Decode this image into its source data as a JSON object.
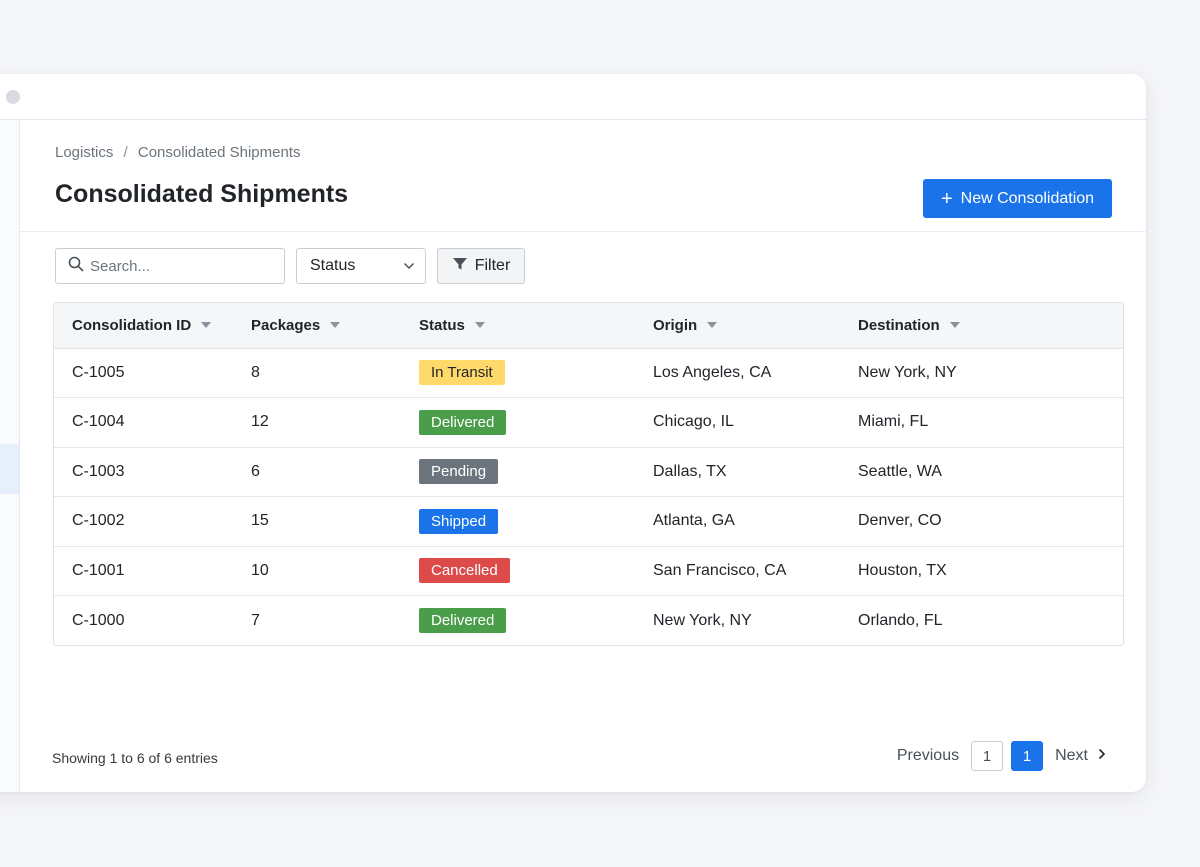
{
  "breadcrumb": {
    "root": "Logistics",
    "separator": "/",
    "current": "Consolidated Shipments"
  },
  "page": {
    "title": "Consolidated Shipments",
    "new_button": "New Consolidation"
  },
  "toolbar": {
    "search_placeholder": "Search...",
    "status_select": "Status",
    "filter_label": "Filter"
  },
  "table": {
    "headers": [
      "Consolidation ID",
      "Packages",
      "Status",
      "Origin",
      "Destination"
    ],
    "rows": [
      {
        "id": "C-1005",
        "packages": "8",
        "status": "In Transit",
        "origin": "Los Angeles, CA",
        "destination": "New York, NY"
      },
      {
        "id": "C-1004",
        "packages": "12",
        "status": "Delivered",
        "origin": "Chicago, IL",
        "destination": "Miami, FL"
      },
      {
        "id": "C-1003",
        "packages": "6",
        "status": "Pending",
        "origin": "Dallas, TX",
        "destination": "Seattle, WA"
      },
      {
        "id": "C-1002",
        "packages": "15",
        "status": "Shipped",
        "origin": "Atlanta, GA",
        "destination": "Denver, CO"
      },
      {
        "id": "C-1001",
        "packages": "10",
        "status": "Cancelled",
        "origin": "San Francisco, CA",
        "destination": "Houston, TX"
      },
      {
        "id": "C-1000",
        "packages": "7",
        "status": "Delivered",
        "origin": "New York, NY",
        "destination": "Orlando, FL"
      }
    ]
  },
  "status_colors": {
    "In Transit": {
      "bg": "#ffd96a",
      "fg": "#212529"
    },
    "Delivered": {
      "bg": "#4a9e4a",
      "fg": "#ffffff"
    },
    "Pending": {
      "bg": "#6c757d",
      "fg": "#ffffff"
    },
    "Shipped": {
      "bg": "#1a73e8",
      "fg": "#ffffff"
    },
    "Cancelled": {
      "bg": "#dc4a4a",
      "fg": "#ffffff"
    }
  },
  "footer": {
    "info": "Showing 1 to 6 of 6 entries",
    "previous": "Previous",
    "pages": [
      "1",
      "1"
    ],
    "next": "Next"
  },
  "colors": {
    "accent": "#1a73e8"
  },
  "icons": {
    "search": "search-icon",
    "filter": "filter-icon",
    "dropdown": "chevron-down-icon",
    "next": "chevron-right-icon",
    "sort": "caret-down-icon",
    "add": "plus-icon"
  }
}
